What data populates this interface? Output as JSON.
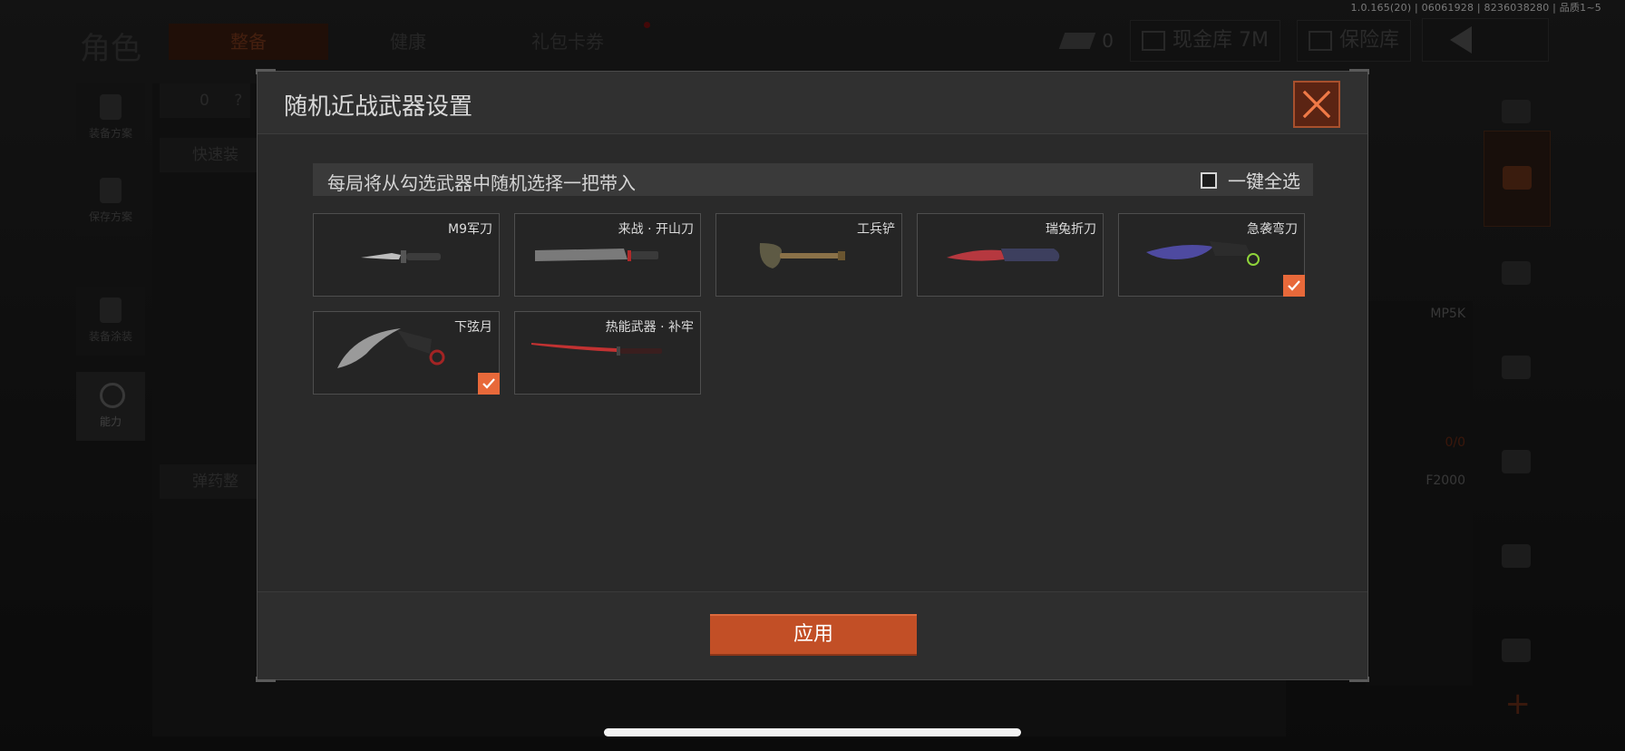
{
  "status": {
    "version": "1.0.165(20) | 06061928 | 8236038280 | 品质1~5"
  },
  "background": {
    "page_title": "角色",
    "tabs": [
      {
        "label": "整备"
      },
      {
        "label": "健康"
      },
      {
        "label": "礼包卡券"
      }
    ],
    "money_value": "0",
    "cash_vault_label": "现金库 7M",
    "insurance_label": "保险库",
    "left_menu": [
      {
        "label": "装备方案"
      },
      {
        "label": "保存方案"
      },
      {
        "label": "装备涂装"
      },
      {
        "label": "能力"
      }
    ],
    "quick_equip_label": "快速装",
    "ammo_label": "弹药整",
    "armor_count": "0",
    "help_mark": "?",
    "weapon_cards": [
      {
        "name": "MP5K",
        "count": "0/0"
      },
      {
        "name": "F2000"
      }
    ]
  },
  "modal": {
    "title": "随机近战武器设置",
    "info_text": "每局将从勾选武器中随机选择一把带入",
    "select_all_label": "一键全选",
    "apply_label": "应用",
    "weapons": [
      {
        "name": "M9军刀",
        "checked": false
      },
      {
        "name": "来战 · 开山刀",
        "checked": false
      },
      {
        "name": "工兵铲",
        "checked": false
      },
      {
        "name": "瑞兔折刀",
        "checked": false
      },
      {
        "name": "急袭弯刀",
        "checked": true
      },
      {
        "name": "下弦月",
        "checked": true
      },
      {
        "name": "热能武器 · 补牢",
        "checked": false
      }
    ],
    "accent_color": "#e8693a"
  }
}
